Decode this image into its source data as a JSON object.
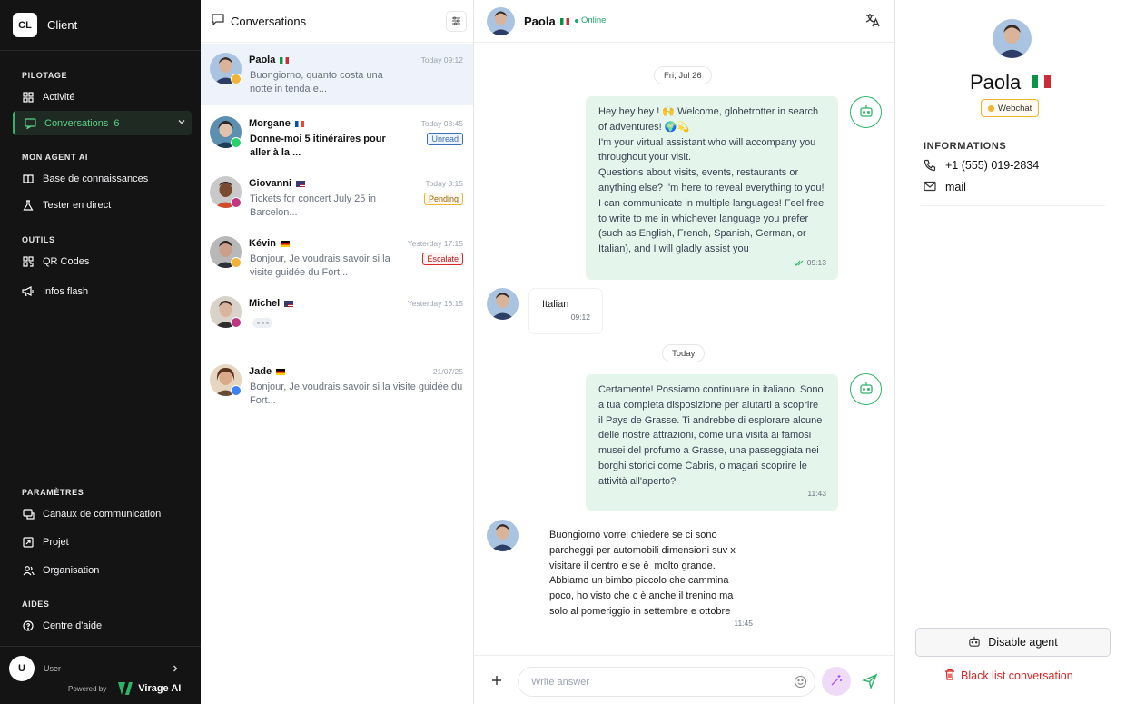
{
  "brand": {
    "initials": "CL",
    "name": "Client"
  },
  "sidebar": {
    "sections": {
      "pilotage": "PILOTAGE",
      "agent": "MON AGENT AI",
      "tools": "OUTILS",
      "settings": "PARAMÈTRES",
      "help": "AIDES"
    },
    "items": [
      {
        "label": "Activité",
        "icon": "grid-icon"
      },
      {
        "label": "Conversations",
        "count": "6",
        "icon": "chat-icon"
      },
      {
        "label": "Base de connaissances",
        "icon": "book-icon"
      },
      {
        "label": "Tester en direct",
        "icon": "flask-icon"
      },
      {
        "label": "QR Codes",
        "icon": "qr-icon"
      },
      {
        "label": "Infos flash",
        "icon": "megaphone-icon"
      },
      {
        "label": "Canaux de communication",
        "icon": "channels-icon"
      },
      {
        "label": "Projet",
        "icon": "project-icon"
      },
      {
        "label": "Organisation",
        "icon": "users-icon"
      },
      {
        "label": "Centre d'aide",
        "icon": "help-icon"
      }
    ],
    "user": {
      "initial": "U",
      "label": "User"
    },
    "powered_by": "Powered by",
    "vendor": "Virage AI"
  },
  "conversations": {
    "title": "Conversations",
    "items": [
      {
        "name": "Paola",
        "flag": "it",
        "time": "Today 09:12",
        "preview": "Buongiorno, quanto costa una notte in tenda e...",
        "channel": "webchat"
      },
      {
        "name": "Morgane",
        "flag": "fr",
        "time": "Today 08:45",
        "preview": "Donne-moi 5 itinéraires pour aller à la ...",
        "tag": "Unread",
        "channel": "whatsapp"
      },
      {
        "name": "Giovanni",
        "flag": "us",
        "time": "Today 8:15",
        "preview": "Tickets for concert July 25 in Barcelon...",
        "tag": "Pending",
        "channel": "instagram"
      },
      {
        "name": "Kévin",
        "flag": "de",
        "time": "Yesterday 17:15",
        "preview": "Bonjour, Je voudrais savoir si la visite guidée du Fort...",
        "tag": "Escalate",
        "channel": "webchat"
      },
      {
        "name": "Michel",
        "flag": "us",
        "time": "Yesterday 16:15",
        "preview": "",
        "channel": "instagram"
      },
      {
        "name": "Jade",
        "flag": "de",
        "time": "21/07/25",
        "preview": "Bonjour, Je voudrais savoir si la visite guidée du Fort...",
        "channel": "messenger"
      }
    ]
  },
  "chat": {
    "contact_name": "Paola",
    "flag": "it",
    "status": "Online",
    "date1": "Fri, Jul 26",
    "date2": "Today",
    "messages": [
      {
        "from": "agent",
        "lines": [
          "Hey hey hey ! 🙌 Welcome, globetrotter in search",
          "of adventures! 🌍💫",
          "I'm your virtual assistant who will accompany you",
          "throughout your visit.",
          "Questions about visits, events, restaurants or",
          "anything else? I'm here to reveal everything to you!",
          "I can communicate in multiple languages! Feel free",
          "to write to me in whichever language you prefer",
          "(such as English, French, Spanish, German, or",
          "Italian), and I will gladly assist you"
        ],
        "time": "09:13"
      },
      {
        "from": "user",
        "lines": [
          "Italian"
        ],
        "time": "09:12"
      },
      {
        "from": "agent",
        "lines": [
          "Certamente! Possiamo continuare in italiano. Sono",
          "a tua completa disposizione per aiutarti a scoprire",
          "il Pays de Grasse. Ti andrebbe di esplorare alcune",
          "delle nostre attrazioni, come una visita ai famosi",
          "musei del profumo a Grasse, una passeggiata nei",
          "borghi storici come Cabris, o magari scoprire le",
          "attività all'aperto?"
        ],
        "time": "11:43"
      },
      {
        "from": "user",
        "lines": [
          "Buongiorno vorrei chiedere se ci sono",
          "parcheggi per automobili dimensioni suv x",
          "visitare il centro e se è  molto grande.",
          "Abbiamo un bimbo piccolo che cammina",
          "poco, ho visto che c è anche il trenino ma",
          "solo al pomeriggio in settembre e ottobre"
        ],
        "time": "11:45"
      }
    ],
    "composer_placeholder": "Write answer"
  },
  "info_panel": {
    "name": "Paola",
    "flag": "it",
    "channel": "Webchat",
    "section": "INFORMATIONS",
    "phone": "+1 (555) 019-2834",
    "mail": "mail",
    "disable_label": "Disable agent",
    "blacklist_label": "Black list conversation"
  },
  "colors": {
    "sidebar_bg": "#141414",
    "accent_green": "#2fb36a",
    "bubble_green": "#e4f6ec",
    "selected_row": "#edf2fb",
    "danger": "#dc2626"
  }
}
